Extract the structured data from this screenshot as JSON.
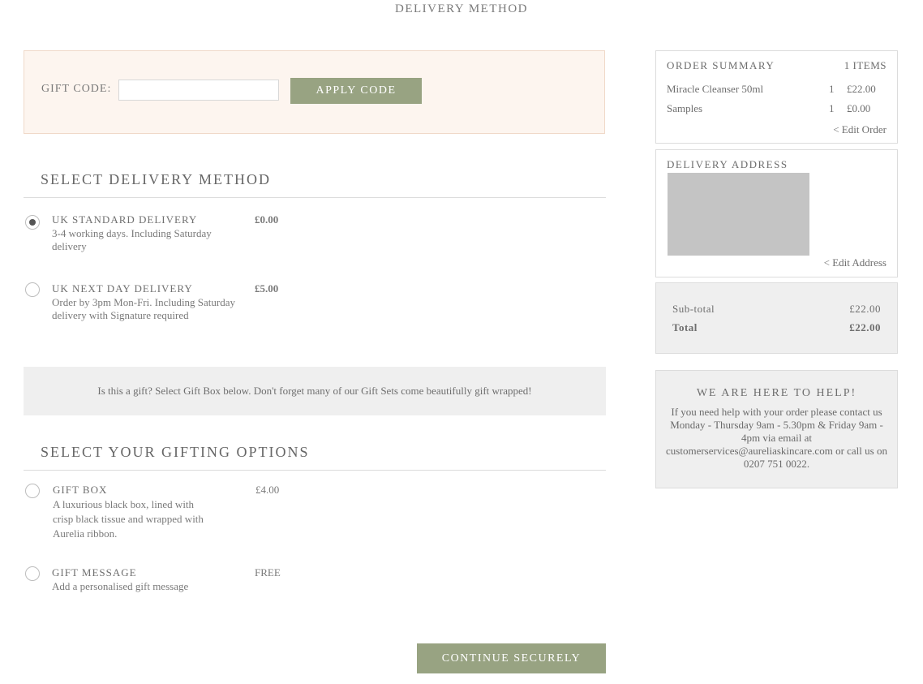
{
  "page": {
    "title": "DELIVERY METHOD"
  },
  "gift_code": {
    "label": "GIFT CODE:",
    "value": "",
    "placeholder": "",
    "apply_label": "APPLY CODE"
  },
  "delivery": {
    "heading": "SELECT DELIVERY METHOD",
    "options": [
      {
        "title": "UK STANDARD DELIVERY",
        "description": "3-4 working days. Including Saturday delivery",
        "price": "£0.00",
        "selected": true
      },
      {
        "title": "UK NEXT DAY DELIVERY",
        "description": "Order by 3pm Mon-Fri. Including Saturday delivery with Signature required",
        "price": "£5.00",
        "selected": false
      }
    ]
  },
  "gift_banner": {
    "text": "Is this a gift? Select Gift Box below. Don't forget many of our Gift Sets come beautifully gift wrapped!"
  },
  "gifting": {
    "heading": "SELECT YOUR GIFTING OPTIONS",
    "options": [
      {
        "title": "GIFT BOX",
        "description": "A luxurious black box, lined with crisp black tissue and wrapped with Aurelia ribbon.",
        "price": "£4.00",
        "selected": false
      },
      {
        "title": "GIFT MESSAGE",
        "description": "Add a personalised gift message",
        "price": "FREE",
        "selected": false
      }
    ]
  },
  "continue_label": "CONTINUE SECURELY",
  "order_summary": {
    "heading": "ORDER SUMMARY",
    "items_count": "1 ITEMS",
    "items": [
      {
        "name": "Miracle Cleanser 50ml",
        "qty": "1",
        "price": "£22.00"
      },
      {
        "name": "Samples",
        "qty": "1",
        "price": "£0.00"
      }
    ],
    "edit_label": "< Edit Order"
  },
  "delivery_address": {
    "heading": "DELIVERY ADDRESS",
    "edit_label": "< Edit Address"
  },
  "totals": {
    "subtotal_label": "Sub-total",
    "subtotal_value": "£22.00",
    "total_label": "Total",
    "total_value": "£22.00"
  },
  "help": {
    "heading": "WE ARE HERE TO HELP!",
    "text": "If you need help with your order please contact us Monday - Thursday 9am - 5.30pm & Friday 9am - 4pm via email at customerservices@aureliaskincare.com or call us on 0207 751 0022."
  },
  "colors": {
    "accent_button": "#98a382",
    "gift_code_bg": "#fdf5ef",
    "panel_gray": "#efefef",
    "text": "#6b6b6b"
  }
}
